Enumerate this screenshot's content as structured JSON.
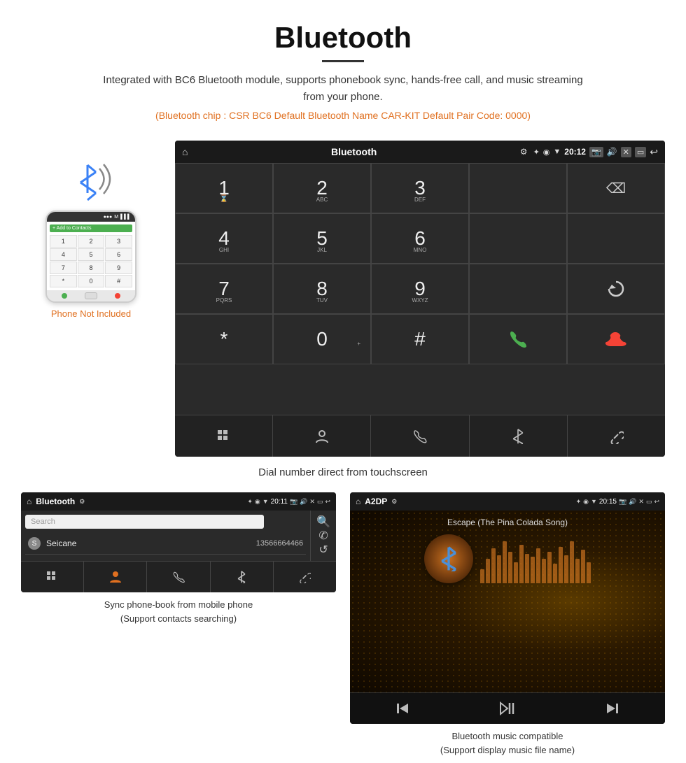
{
  "header": {
    "title": "Bluetooth",
    "description": "Integrated with BC6 Bluetooth module, supports phonebook sync, hands-free call, and music streaming from your phone.",
    "bt_info": "(Bluetooth chip : CSR BC6    Default Bluetooth Name CAR-KIT    Default Pair Code: 0000)"
  },
  "car_screen_large": {
    "title": "Bluetooth",
    "time": "20:12",
    "dialpad": [
      {
        "num": "1",
        "sub": ""
      },
      {
        "num": "2",
        "sub": "ABC"
      },
      {
        "num": "3",
        "sub": "DEF"
      },
      {
        "num": "",
        "sub": ""
      },
      {
        "num": "⌫",
        "sub": ""
      },
      {
        "num": "4",
        "sub": "GHI"
      },
      {
        "num": "5",
        "sub": "JKL"
      },
      {
        "num": "6",
        "sub": "MNO"
      },
      {
        "num": "",
        "sub": ""
      },
      {
        "num": "",
        "sub": ""
      },
      {
        "num": "7",
        "sub": "PQRS"
      },
      {
        "num": "8",
        "sub": "TUV"
      },
      {
        "num": "9",
        "sub": "WXYZ"
      },
      {
        "num": "",
        "sub": ""
      },
      {
        "num": "↺",
        "sub": ""
      },
      {
        "num": "*",
        "sub": ""
      },
      {
        "num": "0",
        "sub": "+"
      },
      {
        "num": "#",
        "sub": ""
      },
      {
        "num": "✆green",
        "sub": ""
      },
      {
        "num": "✆red",
        "sub": ""
      }
    ],
    "bottom_nav": [
      "⊞",
      "👤",
      "✆",
      "✦",
      "🔗"
    ]
  },
  "phone_area": {
    "not_included": "Phone Not Included"
  },
  "main_caption": "Dial number direct from touchscreen",
  "phonebook_screen": {
    "title": "Bluetooth",
    "time": "20:11",
    "search_placeholder": "Search",
    "contacts": [
      {
        "letter": "S",
        "name": "Seicane",
        "number": "13566664466"
      }
    ],
    "bottom_nav": [
      "⊞",
      "👤",
      "✆",
      "✦",
      "🔗"
    ]
  },
  "music_screen": {
    "title": "A2DP",
    "time": "20:15",
    "song_title": "Escape (The Pina Colada Song)",
    "eq_heights": [
      20,
      35,
      50,
      40,
      60,
      45,
      30,
      55,
      42,
      38,
      50,
      35,
      45,
      28,
      52,
      40,
      60,
      35,
      48,
      30
    ]
  },
  "captions": {
    "phonebook": "Sync phone-book from mobile phone\n(Support contacts searching)",
    "music": "Bluetooth music compatible\n(Support display music file name)"
  }
}
